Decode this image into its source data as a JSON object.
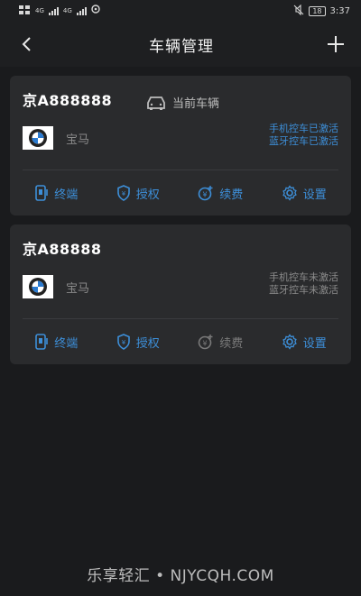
{
  "status_bar": {
    "carrier1": "4G",
    "carrier2": "4G",
    "battery": "18",
    "time": "3:37"
  },
  "nav": {
    "title": "车辆管理"
  },
  "vehicles": [
    {
      "plate": "京A888888",
      "current_label": "当前车辆",
      "brand": "宝马",
      "status1": "手机控车已激活",
      "status2": "蓝牙控车已激活",
      "actions": {
        "terminal": "终端",
        "auth": "授权",
        "renew": "续费",
        "settings": "设置"
      }
    },
    {
      "plate": "京A88888",
      "brand": "宝马",
      "status1": "手机控车未激活",
      "status2": "蓝牙控车未激活",
      "actions": {
        "terminal": "终端",
        "auth": "授权",
        "renew": "续费",
        "settings": "设置"
      }
    }
  ],
  "watermark": "乐享轻汇 • NJYCQH.COM",
  "colors": {
    "accent": "#3d8fd9",
    "background": "#1a1b1d",
    "card": "#2a2b2d"
  }
}
